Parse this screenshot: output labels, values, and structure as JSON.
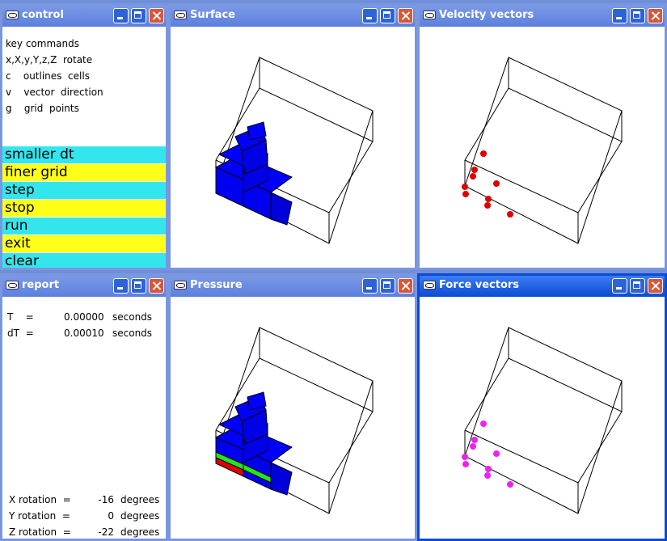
{
  "windows": {
    "control": {
      "title": "control"
    },
    "surface": {
      "title": "Surface"
    },
    "velocity": {
      "title": "Velocity vectors"
    },
    "report": {
      "title": "report"
    },
    "pressure": {
      "title": "Pressure"
    },
    "force": {
      "title": "Force vectors"
    }
  },
  "control": {
    "key_commands": [
      "key commands",
      "x,X,y,Y,z,Z  rotate",
      "c    outlines  cells",
      "v    vector  direction",
      "g    grid  points"
    ],
    "buttons": [
      {
        "label": "smaller  dt",
        "color": "#33e6ee"
      },
      {
        "label": "finer  grid",
        "color": "#ffff1a"
      },
      {
        "label": "step",
        "color": "#33e6ee"
      },
      {
        "label": "stop",
        "color": "#ffff1a"
      },
      {
        "label": "run",
        "color": "#33e6ee"
      },
      {
        "label": "exit",
        "color": "#ffff1a"
      },
      {
        "label": "clear",
        "color": "#33e6ee"
      }
    ]
  },
  "report": {
    "t_label": "T    =",
    "t_value": "0.00000",
    "dt_label": "dT  =",
    "dt_value": "0.00010",
    "time_unit": "seconds",
    "rotations": [
      {
        "label": "X rotation  =",
        "value": "-16",
        "unit": "degrees"
      },
      {
        "label": "Y rotation  =",
        "value": "0",
        "unit": "degrees"
      },
      {
        "label": "Z rotation  =",
        "value": "-22",
        "unit": "degrees"
      }
    ]
  },
  "colors": {
    "title_active": "#0a4bd4",
    "title_inactive": "#7a96df",
    "cell_blue": "#0000f0",
    "cell_green": "#22e622",
    "cell_red": "#e00000",
    "velocity_dot": "#e00000",
    "force_dot": "#ee22ee"
  }
}
